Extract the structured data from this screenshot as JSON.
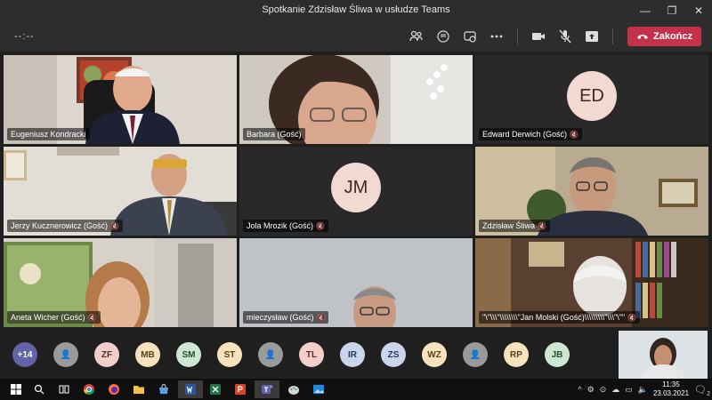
{
  "window": {
    "title": "Spotkanie Zdzisław Śliwa w usłudze Teams",
    "minimize": "—",
    "maximize": "❐",
    "close": "✕"
  },
  "toolbar": {
    "timer": "--:--",
    "hangup_label": "Zakończ"
  },
  "tiles": [
    {
      "name": "Eugeniusz Kondracki",
      "muted": false
    },
    {
      "name": "Barbara (Gość)",
      "muted": false
    },
    {
      "name": "Edward Derwich (Gość)",
      "muted": true,
      "initials": "ED"
    },
    {
      "name": "Jerzy Kucznerowicz (Gość)",
      "muted": true
    },
    {
      "name": "Jola Mrozik (Gość)",
      "muted": true,
      "initials": "JM"
    },
    {
      "name": "Zdzisław Śliwa",
      "muted": true
    },
    {
      "name": "Aneta Wicher (Gość)",
      "muted": true
    },
    {
      "name": "mieczysław (Gość)",
      "muted": true
    },
    {
      "name": "\"\\\"\\\\\\\"\\\\\\\\\\\\\\\\\"Jan Molski (Gość)\\\\\\\\\\\\\\\\\\\"\\\\\\\"\\\"\"",
      "muted": true
    }
  ],
  "roster": [
    {
      "label": "+14",
      "color": "#6264a7",
      "text_color": "#ffffff"
    },
    {
      "label": "👤",
      "color": "#9a9a9a",
      "text_color": "#ffffff"
    },
    {
      "label": "ZF",
      "color": "#f4cfc9",
      "text_color": "#5a2b25"
    },
    {
      "label": "MB",
      "color": "#f6e2bd",
      "text_color": "#5a4318"
    },
    {
      "label": "SM",
      "color": "#cfe6d2",
      "text_color": "#23502b"
    },
    {
      "label": "ST",
      "color": "#f6e2bd",
      "text_color": "#5a4318"
    },
    {
      "label": "👤",
      "color": "#9a9a9a",
      "text_color": "#ffffff"
    },
    {
      "label": "TL",
      "color": "#f4cfc9",
      "text_color": "#5a2b25"
    },
    {
      "label": "IR",
      "color": "#c9d5ea",
      "text_color": "#23395a"
    },
    {
      "label": "ZS",
      "color": "#c9d5ea",
      "text_color": "#23395a"
    },
    {
      "label": "WZ",
      "color": "#f6e2bd",
      "text_color": "#5a4318"
    },
    {
      "label": "👤",
      "color": "#9a9a9a",
      "text_color": "#ffffff"
    },
    {
      "label": "RP",
      "color": "#f6e2bd",
      "text_color": "#5a4318"
    },
    {
      "label": "JB",
      "color": "#cfe6d2",
      "text_color": "#23502b"
    }
  ],
  "taskbar": {
    "time": "11:35",
    "date": "23.03.2021",
    "notifications": "2"
  }
}
